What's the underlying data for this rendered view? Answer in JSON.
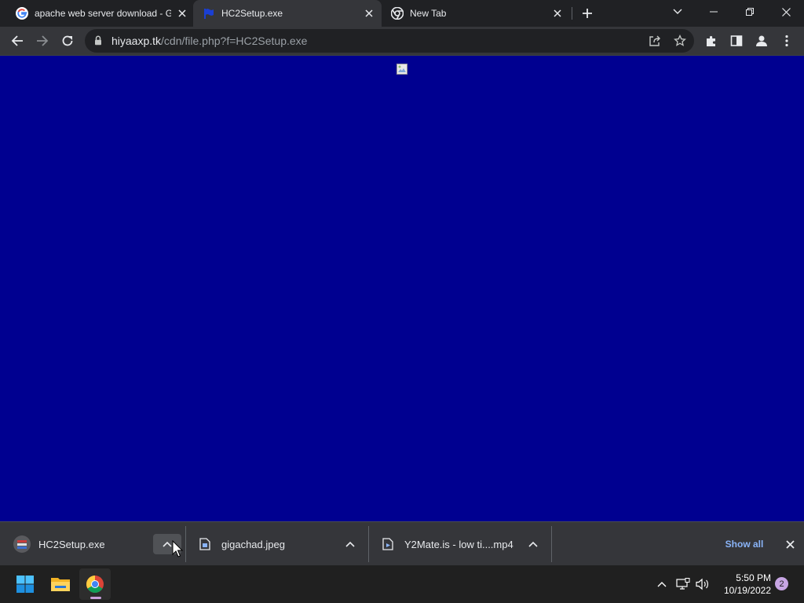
{
  "browser": {
    "tabs": [
      {
        "title": "apache web server download - G",
        "favicon": "google-g-icon",
        "active": false
      },
      {
        "title": "HC2Setup.exe",
        "favicon": "blue-flag-icon",
        "active": true
      },
      {
        "title": "New Tab",
        "favicon": "chrome-icon",
        "active": false
      }
    ],
    "new_tab_icon": "plus-icon",
    "address": {
      "host": "hiyaaxp.tk",
      "path": "/cdn/file.php?f=HC2Setup.exe",
      "security_icon": "lock-icon"
    }
  },
  "page": {
    "background_color": "#000090",
    "content_icon": "broken-image-icon"
  },
  "downloads": {
    "items": [
      {
        "name": "HC2Setup.exe",
        "icon": "installer-icon"
      },
      {
        "name": "gigachad.jpeg",
        "icon": "file-icon"
      },
      {
        "name": "Y2Mate.is - low ti....mp4",
        "icon": "file-icon"
      }
    ],
    "show_all_label": "Show all"
  },
  "taskbar": {
    "apps": [
      "start-icon",
      "file-explorer-icon",
      "chrome-icon"
    ],
    "time": "5:50 PM",
    "date": "10/19/2022",
    "notification_count": "2"
  },
  "colors": {
    "accent_link": "#8ab4f8",
    "page_bg": "#000090",
    "chrome_dark": "#202124",
    "toolbar": "#35363a"
  }
}
